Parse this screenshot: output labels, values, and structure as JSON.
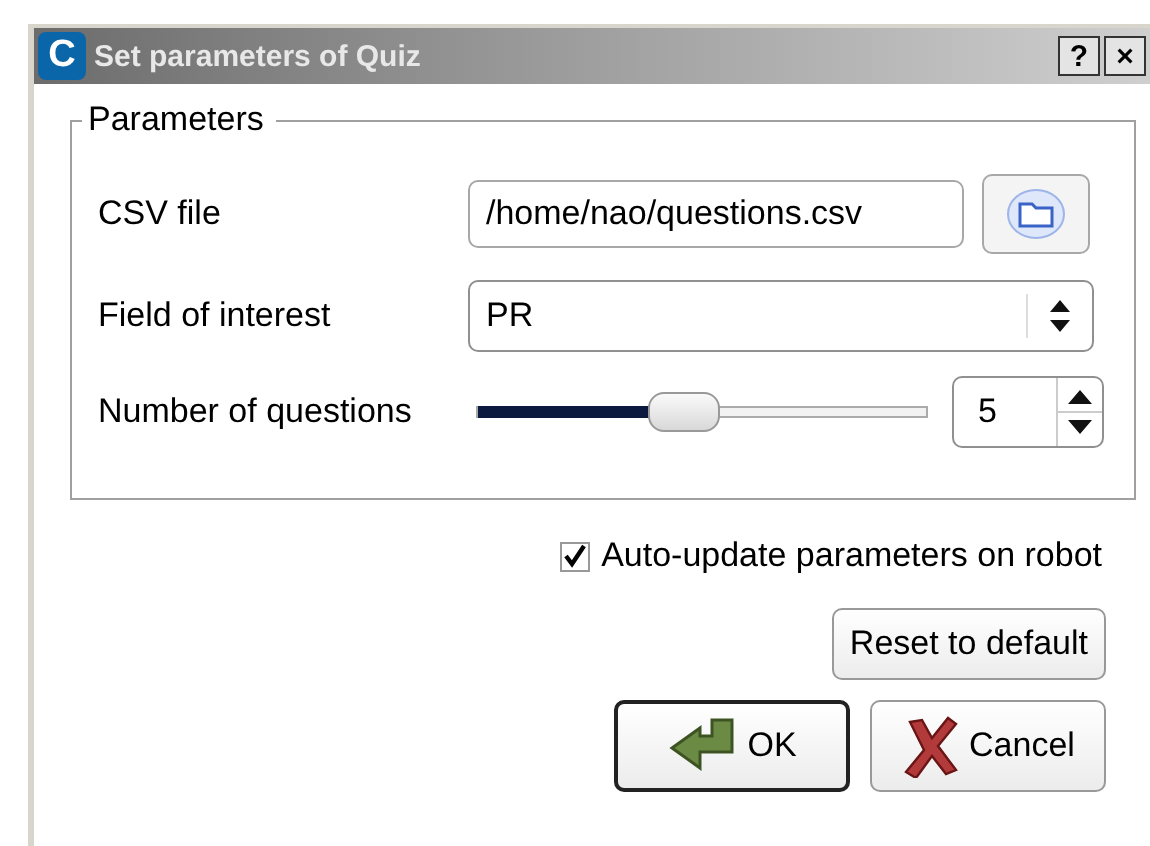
{
  "window": {
    "app_icon_letter": "C",
    "title": "Set parameters of Quiz",
    "help_button": "?",
    "close_button": "×"
  },
  "parameters": {
    "title": "Parameters",
    "csv_file": {
      "label": "CSV file",
      "value": "/home/nao/questions.csv"
    },
    "field_of_interest": {
      "label": "Field of interest",
      "value": "PR"
    },
    "number_of_questions": {
      "label": "Number of questions",
      "level": 0.45,
      "value": "5"
    }
  },
  "auto_update": {
    "label": "Auto-update parameters on robot",
    "checked": true
  },
  "buttons": [
    {
      "kind": "reset",
      "label": "Reset to default",
      "default": false
    },
    {
      "kind": "ok",
      "label": "OK",
      "default": true
    },
    {
      "kind": "cancel",
      "label": "Cancel",
      "default": false
    }
  ]
}
